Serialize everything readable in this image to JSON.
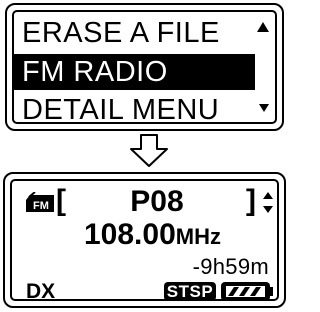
{
  "menu": {
    "items": [
      {
        "label": "ERASE A FILE",
        "selected": false
      },
      {
        "label": "FM RADIO",
        "selected": true
      },
      {
        "label": "DETAIL MENU",
        "selected": false
      }
    ],
    "scroll_up_icon": "triangle-up-icon",
    "scroll_down_icon": "triangle-down-icon"
  },
  "transition_icon": "hollow-down-arrow-icon",
  "radio": {
    "mode_icon": "fm-icon",
    "mode_icon_text": "FM",
    "bracket_left": "[",
    "bracket_right": "]",
    "preset": "P08",
    "frequency_value": "108.00",
    "frequency_unit": "MHz",
    "remaining_time": "-9h59m",
    "dx_label": "DX",
    "stereo_badge": "STSP",
    "battery_icon": "battery-icon"
  }
}
